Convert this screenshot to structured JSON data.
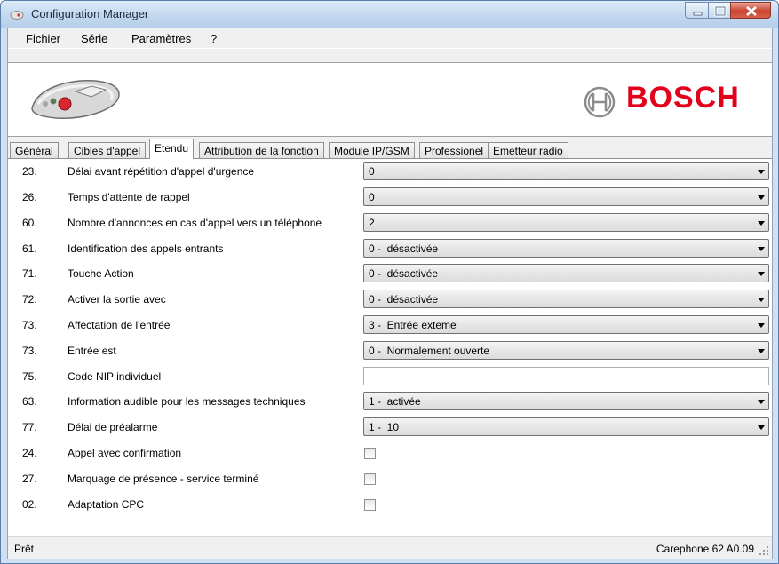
{
  "window": {
    "title": "Configuration Manager"
  },
  "menu": [
    "Fichier",
    "Série",
    "Paramètres",
    "?"
  ],
  "brand": {
    "name": "BOSCH",
    "color": "#e2001a"
  },
  "tabs": [
    {
      "label": "Général",
      "active": false
    },
    {
      "label": "Cibles d'appel",
      "active": false
    },
    {
      "label": "Etendu",
      "active": true
    },
    {
      "label": "Attribution de la fonction",
      "active": false
    },
    {
      "label": "Module IP/GSM",
      "active": false
    },
    {
      "label": "Professionel",
      "active": false
    },
    {
      "label": "Emetteur radio",
      "active": false
    }
  ],
  "rows": [
    {
      "num": "23.",
      "label": "Délai avant répétition d'appel d'urgence",
      "control": "select",
      "value": "0"
    },
    {
      "num": "26.",
      "label": "Temps d'attente de rappel",
      "control": "select",
      "value": "0"
    },
    {
      "num": "60.",
      "label": "Nombre d'annonces en cas d'appel vers un téléphone",
      "control": "select",
      "value": "2"
    },
    {
      "num": "61.",
      "label": "Identification des appels entrants",
      "control": "select",
      "value": "0 -  désactivée"
    },
    {
      "num": "71.",
      "label": "Touche Action",
      "control": "select",
      "value": "0 -  désactivée"
    },
    {
      "num": "72.",
      "label": "Activer la sortie avec",
      "control": "select",
      "value": "0 -  désactivée"
    },
    {
      "num": "73.",
      "label": "Affectation de l'entrée",
      "control": "select",
      "value": "3 -  Entrée exteme"
    },
    {
      "num": "73.",
      "label": "Entrée est",
      "control": "select",
      "value": "0 -  Normalement ouverte"
    },
    {
      "num": "75.",
      "label": "Code NIP individuel",
      "control": "text",
      "value": ""
    },
    {
      "num": "63.",
      "label": "Information audible pour les messages techniques",
      "control": "select",
      "value": "1 -  activée"
    },
    {
      "num": "77.",
      "label": "Délai de préalarme",
      "control": "select",
      "value": "1 -  10"
    },
    {
      "num": "24.",
      "label": "Appel avec confirmation",
      "control": "checkbox",
      "checked": false
    },
    {
      "num": "27.",
      "label": "Marquage de présence - service terminé",
      "control": "checkbox",
      "checked": false
    },
    {
      "num": "02.",
      "label": "Adaptation CPC",
      "control": "checkbox",
      "checked": false
    }
  ],
  "status": {
    "left": "Prêt",
    "right": "Carephone 62 A0.09"
  }
}
